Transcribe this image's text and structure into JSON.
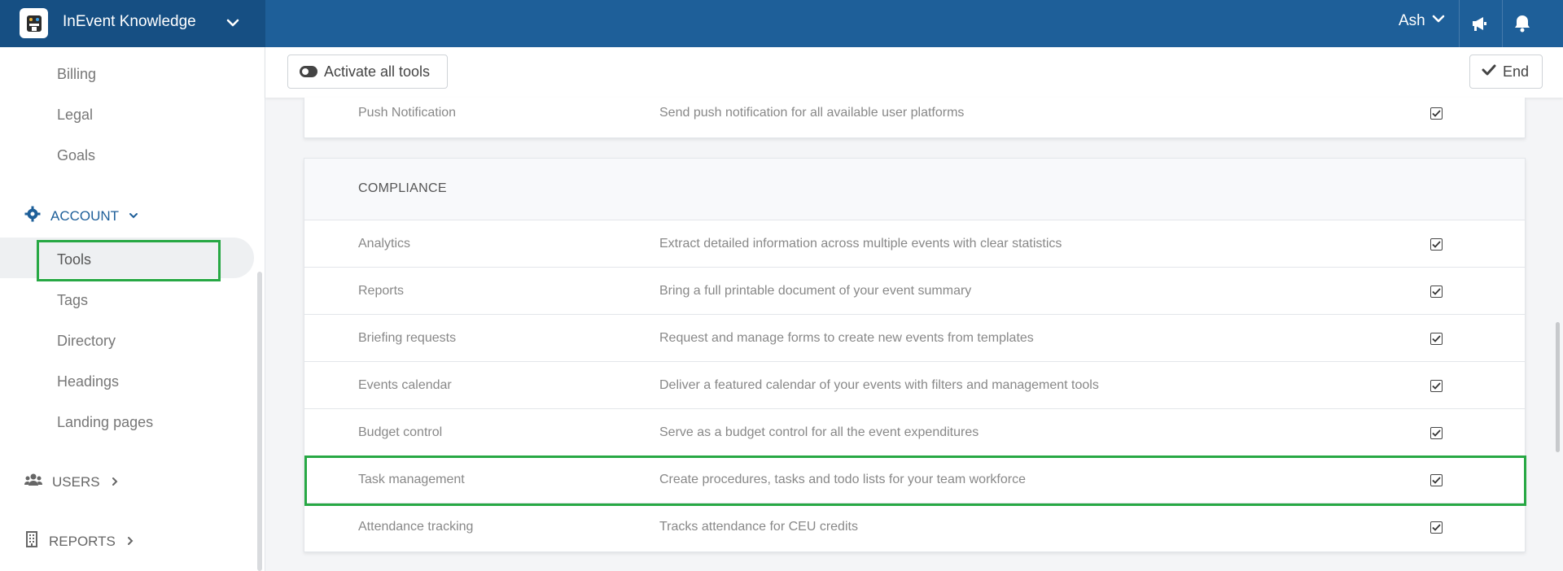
{
  "app": {
    "title": "InEvent Knowledge",
    "user": "Ash"
  },
  "sidebar": {
    "items_top": [
      {
        "label": "Billing"
      },
      {
        "label": "Legal"
      },
      {
        "label": "Goals"
      }
    ],
    "account_section": "ACCOUNT",
    "account_items": [
      {
        "label": "Tools",
        "active": true
      },
      {
        "label": "Tags"
      },
      {
        "label": "Directory"
      },
      {
        "label": "Headings"
      },
      {
        "label": "Landing pages"
      }
    ],
    "users_section": "USERS",
    "reports_section": "REPORTS"
  },
  "toolbar": {
    "activate_label": "Activate all tools",
    "end_label": "End"
  },
  "top_card": {
    "rows": [
      {
        "name": "Push Notification",
        "desc": "Send push notification for all available user platforms",
        "checked": true
      }
    ]
  },
  "compliance": {
    "title": "COMPLIANCE",
    "rows": [
      {
        "name": "Analytics",
        "desc": "Extract detailed information across multiple events with clear statistics",
        "checked": true
      },
      {
        "name": "Reports",
        "desc": "Bring a full printable document of your event summary",
        "checked": true
      },
      {
        "name": "Briefing requests",
        "desc": "Request and manage forms to create new events from templates",
        "checked": true
      },
      {
        "name": "Events calendar",
        "desc": "Deliver a featured calendar of your events with filters and management tools",
        "checked": true
      },
      {
        "name": "Budget control",
        "desc": "Serve as a budget control for all the event expenditures",
        "checked": true
      },
      {
        "name": "Task management",
        "desc": "Create procedures, tasks and todo lists for your team workforce",
        "checked": true
      },
      {
        "name": "Attendance tracking",
        "desc": "Tracks attendance for CEU credits",
        "checked": true
      }
    ]
  },
  "colors": {
    "topbar": "#1e5f99",
    "brand_bg": "#164f83",
    "accent": "#1e5f99",
    "highlight": "#27a844"
  }
}
